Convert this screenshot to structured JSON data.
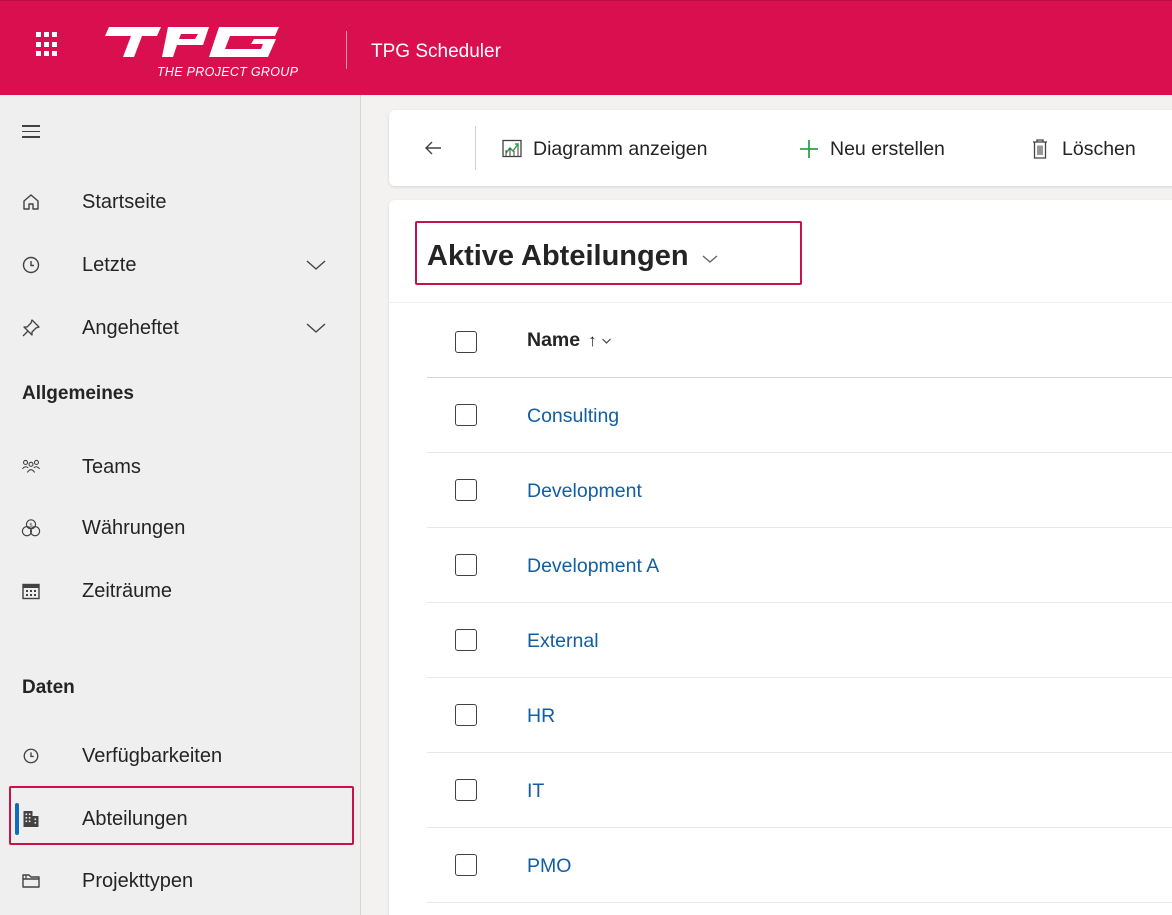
{
  "header": {
    "brand_sub": "THE PROJECT GROUP",
    "app_title": "TPG Scheduler",
    "brand_color": "#d90f50",
    "icons": {
      "waffle": "app-launcher-icon",
      "logo": "tpg-logo"
    }
  },
  "sidebar": {
    "top_items": [
      {
        "label": "Startseite",
        "icon": "home-icon"
      },
      {
        "label": "Letzte",
        "icon": "clock-icon",
        "expandable": true
      },
      {
        "label": "Angeheftet",
        "icon": "pin-icon",
        "expandable": true
      }
    ],
    "sections": [
      {
        "title": "Allgemeines",
        "items": [
          {
            "label": "Teams",
            "icon": "people-icon"
          },
          {
            "label": "Währungen",
            "icon": "currency-icon"
          },
          {
            "label": "Zeiträume",
            "icon": "calendar-icon"
          }
        ]
      },
      {
        "title": "Daten",
        "items": [
          {
            "label": "Verfügbarkeiten",
            "icon": "clock-icon"
          },
          {
            "label": "Abteilungen",
            "icon": "building-icon",
            "selected": true
          },
          {
            "label": "Projekttypen",
            "icon": "folder-icon"
          }
        ]
      }
    ]
  },
  "commandbar": {
    "back_icon": "back-arrow-icon",
    "buttons": [
      {
        "label": "Diagramm anzeigen",
        "icon": "chart-icon"
      },
      {
        "label": "Neu erstellen",
        "icon": "add-icon"
      },
      {
        "label": "Löschen",
        "icon": "trash-icon"
      }
    ]
  },
  "view": {
    "title": "Aktive Abteilungen",
    "columns": [
      {
        "label": "Name",
        "sort": "↑"
      }
    ],
    "rows": [
      "Consulting",
      "Development",
      "Development A",
      "External",
      "HR",
      "IT",
      "PMO"
    ]
  },
  "colors": {
    "accent": "#d90f50",
    "highlight_border": "#c7134a",
    "link": "#115ea3",
    "selected_indicator": "#0f6cbd",
    "add_icon": "#2fa34a"
  }
}
